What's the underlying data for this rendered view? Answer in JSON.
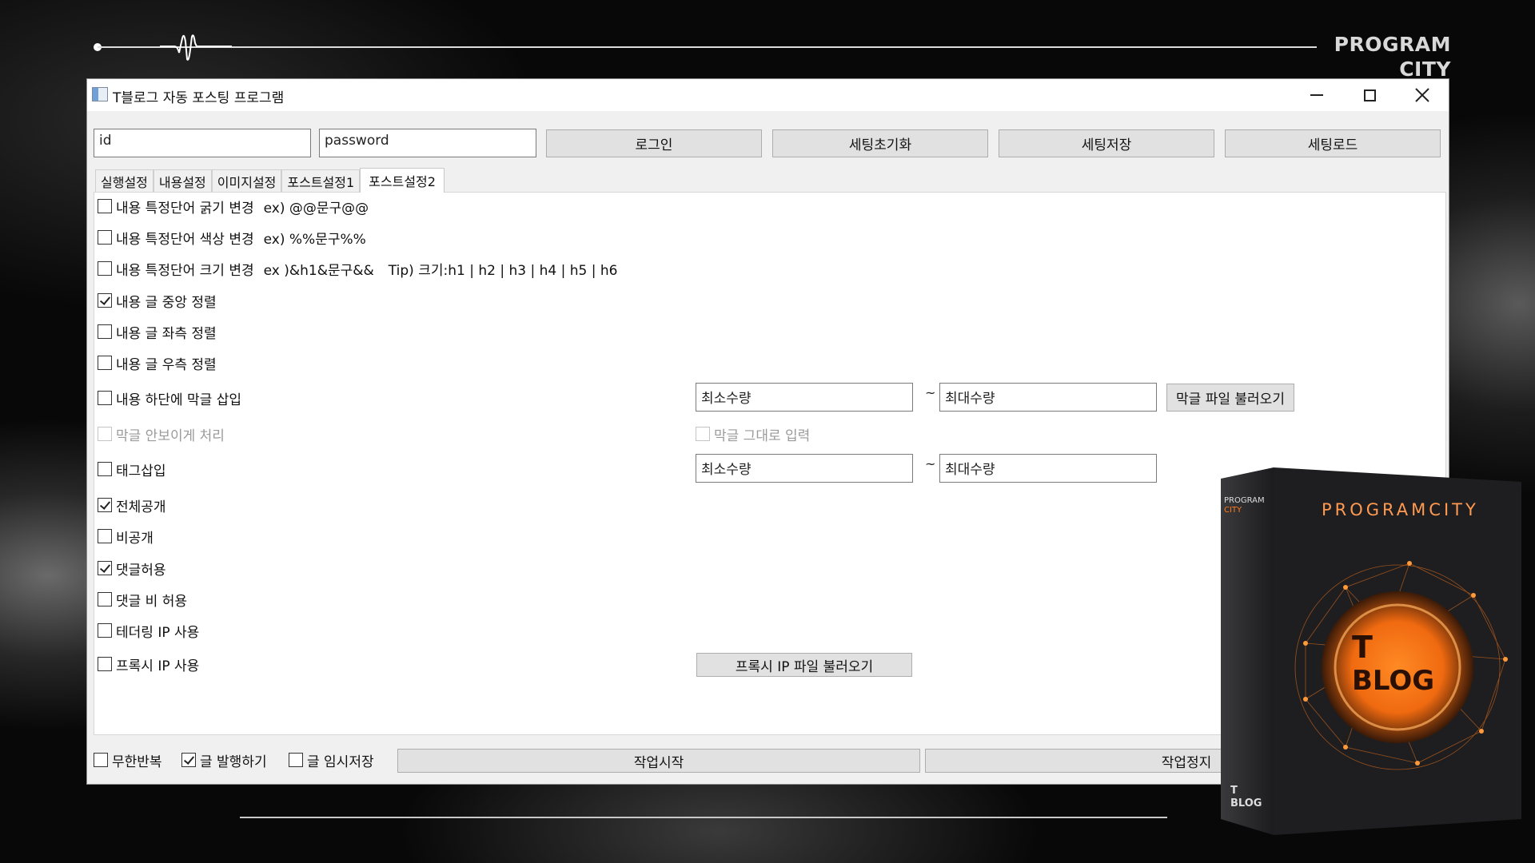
{
  "brand": {
    "line1": "PROGRAM",
    "line2": "CITY"
  },
  "window": {
    "title": "T블로그 자동 포스팅 프로그램",
    "controls": {
      "minimize": "minimize-icon",
      "maximize": "maximize-icon",
      "close": "close-icon"
    }
  },
  "login": {
    "id_value": "id",
    "password_value": "password",
    "login_label": "로그인",
    "reset_label": "세팅초기화",
    "save_label": "세팅저장",
    "load_label": "세팅로드"
  },
  "tabs": [
    {
      "label": "실행설정",
      "active": false
    },
    {
      "label": "내용설정",
      "active": false
    },
    {
      "label": "이미지설정",
      "active": false
    },
    {
      "label": "포스트설정1",
      "active": false
    },
    {
      "label": "포스트설정2",
      "active": true
    }
  ],
  "options": {
    "bold": {
      "label": "내용 특정단어 굵기 변경",
      "hint": "ex) @@문구@@",
      "checked": false
    },
    "color": {
      "label": "내용 특정단어 색상 변경",
      "hint": "ex) %%문구%%",
      "checked": false
    },
    "size": {
      "label": "내용 특정단어 크기 변경",
      "hint": "ex )&h1&문구&&",
      "tip": "Tip) 크기:h1 | h2 | h3 | h4 | h5 | h6",
      "checked": false
    },
    "center": {
      "label": "내용 글 중앙 정렬",
      "checked": true
    },
    "left": {
      "label": "내용 글 좌측 정렬",
      "checked": false
    },
    "right": {
      "label": "내용 글 우측 정렬",
      "checked": false
    },
    "filler": {
      "label": "내용 하단에 막글 삽입",
      "checked": false
    },
    "filler_hide": {
      "label": "막글 안보이게 처리",
      "checked": false,
      "disabled": true
    },
    "filler_raw": {
      "label": "막글 그대로 입력",
      "checked": false,
      "disabled": true
    },
    "tags": {
      "label": "태그삽입",
      "checked": false
    },
    "public": {
      "label": "전체공개",
      "checked": true
    },
    "private": {
      "label": "비공개",
      "checked": false
    },
    "comments_allow": {
      "label": "댓글허용",
      "checked": true
    },
    "comments_deny": {
      "label": "댓글 비 허용",
      "checked": false
    },
    "tethering": {
      "label": "테더링 IP 사용",
      "checked": false
    },
    "proxy": {
      "label": "프록시 IP 사용",
      "checked": false
    }
  },
  "filler_range": {
    "min_value": "최소수량",
    "max_value": "최대수량",
    "tilde": "~",
    "load_label": "막글 파일 불러오기"
  },
  "tag_range": {
    "min_value": "최소수량",
    "max_value": "최대수량",
    "tilde": "~"
  },
  "proxy_load_label": "프록시 IP 파일 불러오기",
  "bottom": {
    "loop": {
      "label": "무한반복",
      "checked": false
    },
    "publish": {
      "label": "글 발행하기",
      "checked": true
    },
    "draft": {
      "label": "글 임시저장",
      "checked": false
    },
    "start_label": "작업시작",
    "stop_label": "작업정지"
  },
  "product": {
    "top_label_1": "PROGRAM",
    "top_label_2": "CITY",
    "front_title": "PROGRAMCITY",
    "logo_t": "T",
    "logo_blog": "BLOG",
    "spine_t": "T",
    "spine_blog": "BLOG",
    "accent": "#ff7a1a"
  }
}
